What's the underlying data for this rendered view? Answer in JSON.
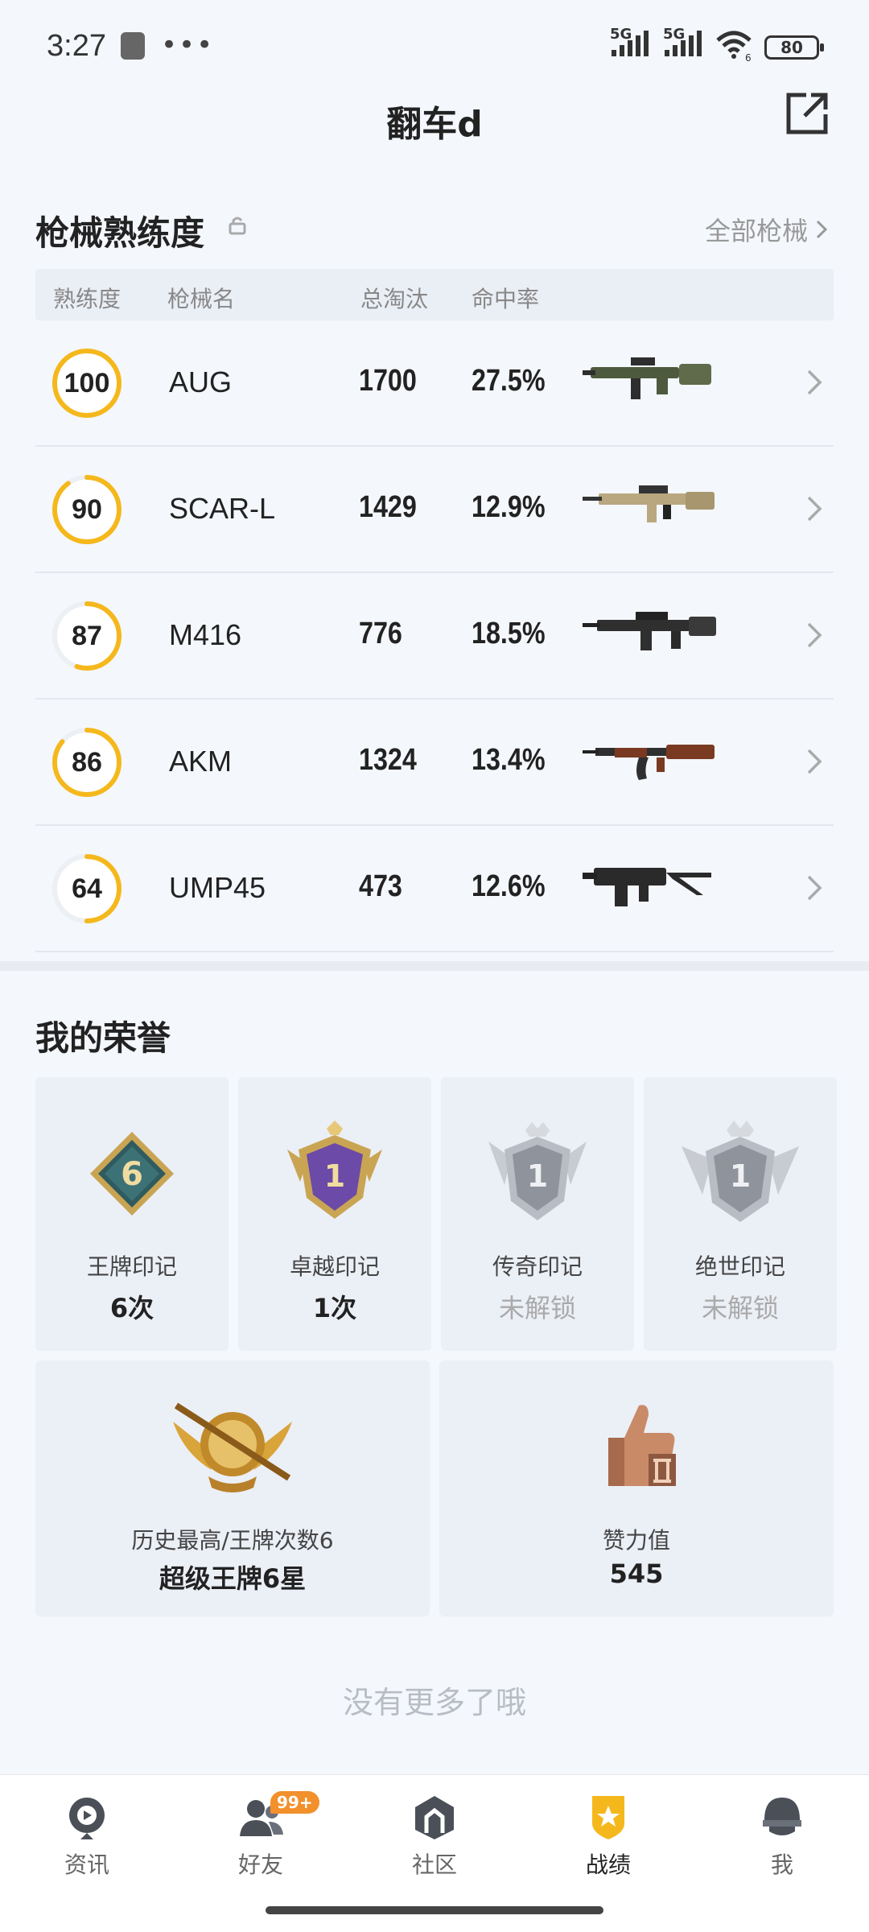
{
  "status_bar": {
    "time": "3:27",
    "signal1": "5G",
    "signal2": "5G",
    "wifi_sub": "6",
    "battery": "80"
  },
  "header": {
    "title": "翻车d"
  },
  "weapons": {
    "title": "枪械熟练度",
    "all_link": "全部枪械",
    "columns": [
      "熟练度",
      "枪械名",
      "总淘汰",
      "命中率"
    ],
    "rows": [
      {
        "proficiency": "100",
        "level": 1.0,
        "name": "AUG",
        "kills": "1700",
        "accuracy": "27.5%"
      },
      {
        "proficiency": "90",
        "level": 0.9,
        "name": "SCAR-L",
        "kills": "1429",
        "accuracy": "12.9%"
      },
      {
        "proficiency": "87",
        "level": 0.55,
        "name": "M416",
        "kills": "776",
        "accuracy": "18.5%"
      },
      {
        "proficiency": "86",
        "level": 0.86,
        "name": "AKM",
        "kills": "1324",
        "accuracy": "13.4%"
      },
      {
        "proficiency": "64",
        "level": 0.5,
        "name": "UMP45",
        "kills": "473",
        "accuracy": "12.6%"
      }
    ]
  },
  "honors": {
    "title": "我的荣誉",
    "cards": [
      {
        "label": "王牌印记",
        "value": "6次",
        "badge_num": "6",
        "locked": false
      },
      {
        "label": "卓越印记",
        "value": "1次",
        "badge_num": "1",
        "locked": false
      },
      {
        "label": "传奇印记",
        "value": "未解锁",
        "badge_num": "1",
        "locked": true
      },
      {
        "label": "绝世印记",
        "value": "未解锁",
        "badge_num": "1",
        "locked": true
      }
    ],
    "best": {
      "label": "历史最高/王牌次数6",
      "value": "超级王牌6星"
    },
    "likes": {
      "label": "赞力值",
      "value": "545"
    }
  },
  "no_more": "没有更多了哦",
  "nav": {
    "items": [
      {
        "label": "资讯",
        "icon": "news-icon"
      },
      {
        "label": "好友",
        "icon": "friends-icon",
        "badge": "99+"
      },
      {
        "label": "社区",
        "icon": "community-icon"
      },
      {
        "label": "战绩",
        "icon": "records-icon",
        "active": true
      },
      {
        "label": "我",
        "icon": "profile-icon"
      }
    ]
  },
  "colors": {
    "ring": "#f5b81c",
    "ring_track": "#eceff4",
    "accent": "#f5b81c",
    "background": "#f4f7fc"
  }
}
